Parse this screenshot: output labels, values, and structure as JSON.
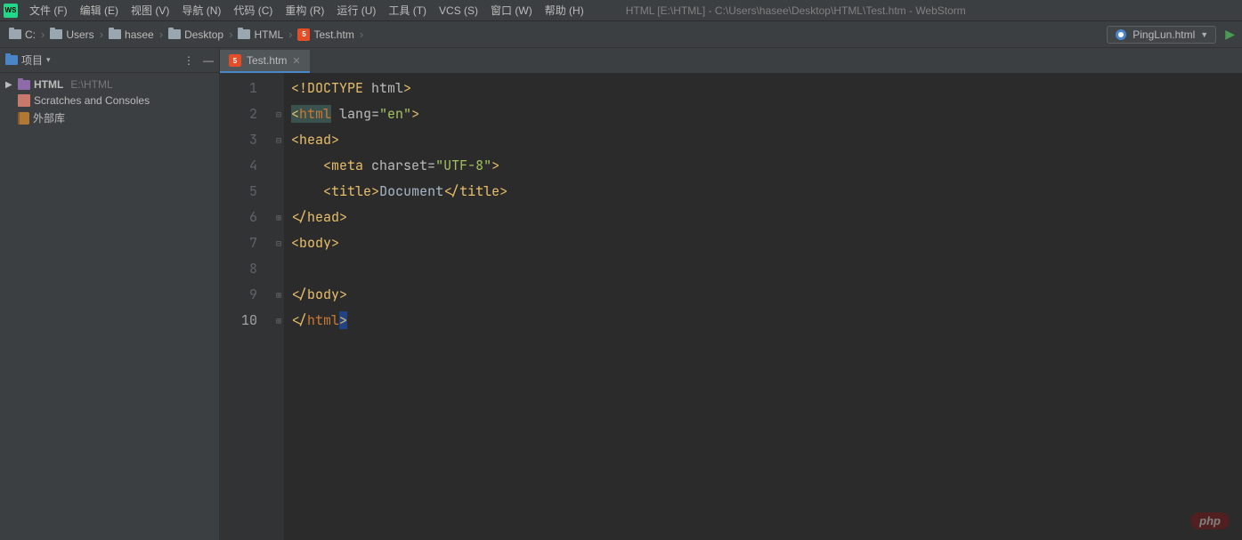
{
  "menubar": {
    "items": [
      "文件 (F)",
      "编辑 (E)",
      "视图 (V)",
      "导航 (N)",
      "代码 (C)",
      "重构 (R)",
      "运行 (U)",
      "工具 (T)",
      "VCS (S)",
      "窗口 (W)",
      "帮助 (H)"
    ]
  },
  "window_title": "HTML [E:\\HTML] - C:\\Users\\hasee\\Desktop\\HTML\\Test.htm - WebStorm",
  "breadcrumb": {
    "items": [
      {
        "icon": "folder",
        "label": "C:"
      },
      {
        "icon": "folder",
        "label": "Users"
      },
      {
        "icon": "folder",
        "label": "hasee"
      },
      {
        "icon": "folder",
        "label": "Desktop"
      },
      {
        "icon": "folder",
        "label": "HTML"
      },
      {
        "icon": "html",
        "label": "Test.htm"
      }
    ]
  },
  "run_config": {
    "label": "PingLun.html"
  },
  "sidebar": {
    "title": "项目",
    "items": [
      {
        "icon": "project",
        "label": "HTML",
        "path": "E:\\HTML",
        "arrow": "▶"
      },
      {
        "icon": "scratches",
        "label": "Scratches and Consoles"
      },
      {
        "icon": "lib",
        "label": "外部库"
      }
    ]
  },
  "editor": {
    "tab_name": "Test.htm",
    "line_numbers": [
      "1",
      "2",
      "3",
      "4",
      "5",
      "6",
      "7",
      "8",
      "9",
      "10"
    ],
    "current_line": 10
  },
  "watermark": "php"
}
